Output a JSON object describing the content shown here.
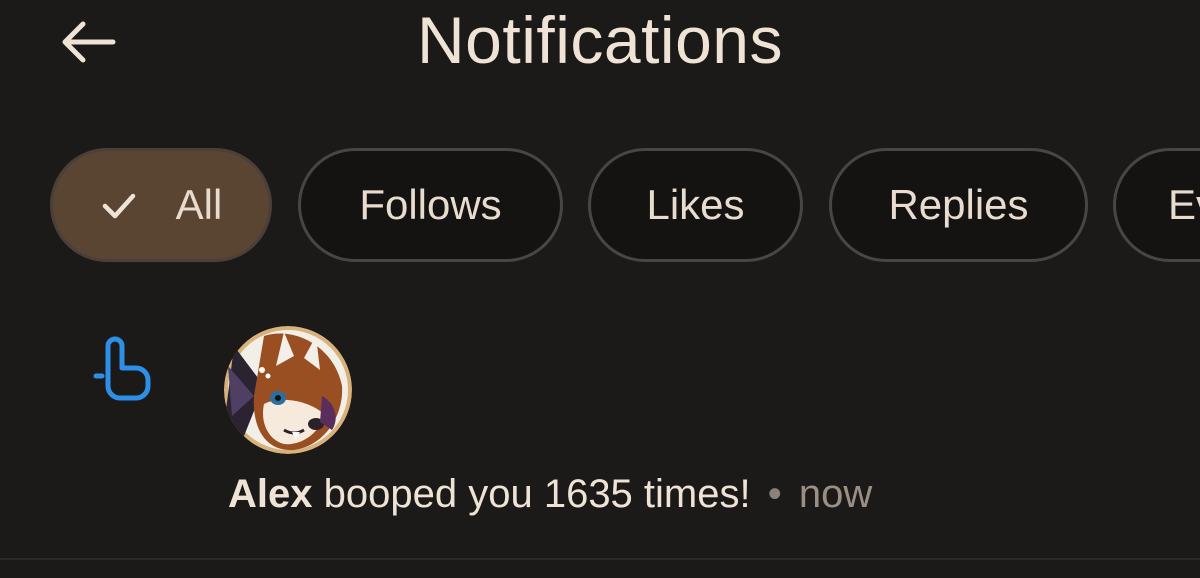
{
  "header": {
    "title": "Notifications",
    "back_icon": "arrow-left-icon"
  },
  "filters": {
    "all": "All",
    "follows": "Follows",
    "likes": "Likes",
    "replies": "Replies",
    "events_partial": "Ev",
    "selected": "All",
    "check_icon": "check-icon"
  },
  "notification": {
    "icon": "tap-finger-icon",
    "avatar": "fox-character-avatar",
    "name": "Alex",
    "message": "booped you 1635 times!",
    "separator": "•",
    "time": "now"
  },
  "colors": {
    "background": "#1b1a19",
    "chip_selected": "#5a4432",
    "chip_border": "#4a4541",
    "text": "#efe3d6",
    "accent_blue": "#2d8fe6"
  }
}
